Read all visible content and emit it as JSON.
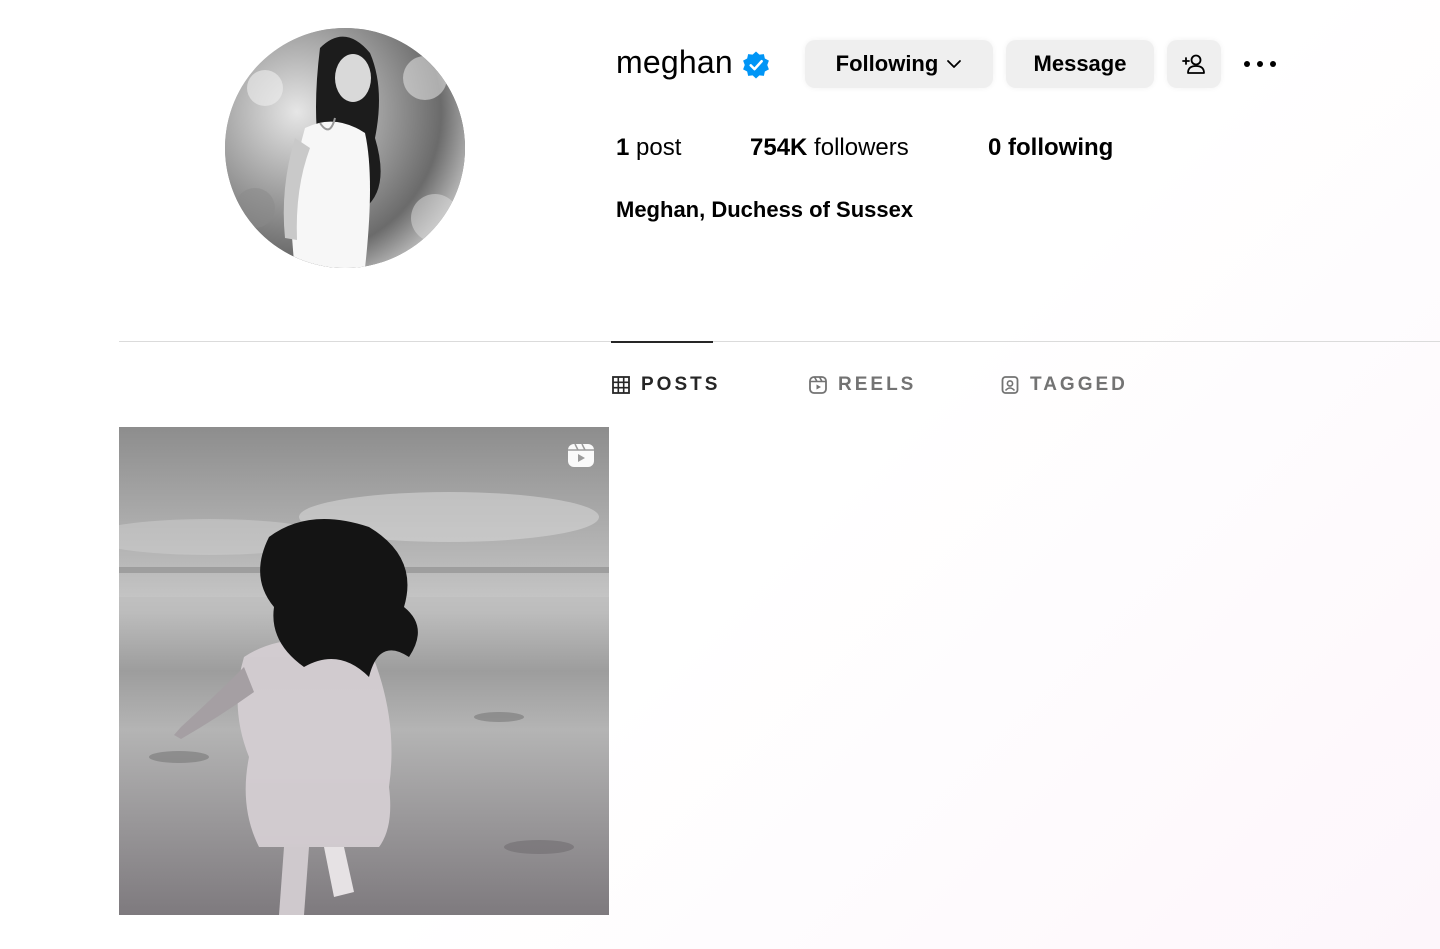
{
  "profile": {
    "username": "meghan",
    "full_name": "Meghan, Duchess of Sussex",
    "verified_icon": "verified-badge-icon",
    "accent_color": "#0095f6"
  },
  "actions": {
    "following_label": "Following",
    "message_label": "Message",
    "add_user_icon": "add-user-icon",
    "more_icon": "more-options-icon"
  },
  "stats": {
    "posts_count": "1",
    "posts_label": "post",
    "followers_count": "754K",
    "followers_label": "followers",
    "following_text": "0 following"
  },
  "tabs": [
    {
      "label": "POSTS",
      "icon": "grid-icon",
      "active": true
    },
    {
      "label": "REELS",
      "icon": "reels-icon",
      "active": false
    },
    {
      "label": "TAGGED",
      "icon": "tagged-icon",
      "active": false
    }
  ],
  "posts": [
    {
      "type": "reel",
      "icon": "reel-icon"
    }
  ]
}
